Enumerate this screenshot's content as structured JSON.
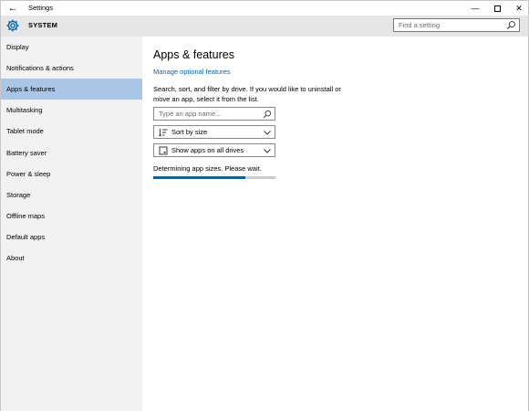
{
  "window": {
    "title": "Settings",
    "back_glyph": "←",
    "min_glyph": "—",
    "close_glyph": "✕"
  },
  "header": {
    "section": "SYSTEM",
    "search_placeholder": "Find a setting",
    "icon": "gear-icon"
  },
  "sidebar": {
    "items": [
      {
        "label": "Display"
      },
      {
        "label": "Notifications & actions"
      },
      {
        "label": "Apps & features",
        "selected": true
      },
      {
        "label": "Multitasking"
      },
      {
        "label": "Tablet mode"
      },
      {
        "label": "Battery saver"
      },
      {
        "label": "Power & sleep"
      },
      {
        "label": "Storage"
      },
      {
        "label": "Offline maps"
      },
      {
        "label": "Default apps"
      },
      {
        "label": "About"
      }
    ]
  },
  "main": {
    "title": "Apps & features",
    "link": "Manage optional features",
    "description": "Search, sort, and filter by drive. If you would like to uninstall or move an app, select it from the list.",
    "search_placeholder": "Type an app name...",
    "sort_value": "Sort by size",
    "drive_value": "Show apps on all drives",
    "status": "Determining app sizes. Please wait.",
    "progress": 0.75
  },
  "colors": {
    "accent": "#0063b1",
    "selected": "#a9c6e6",
    "sidebar_bg": "#f2f2f2",
    "header_bg": "#e6e6e6"
  }
}
